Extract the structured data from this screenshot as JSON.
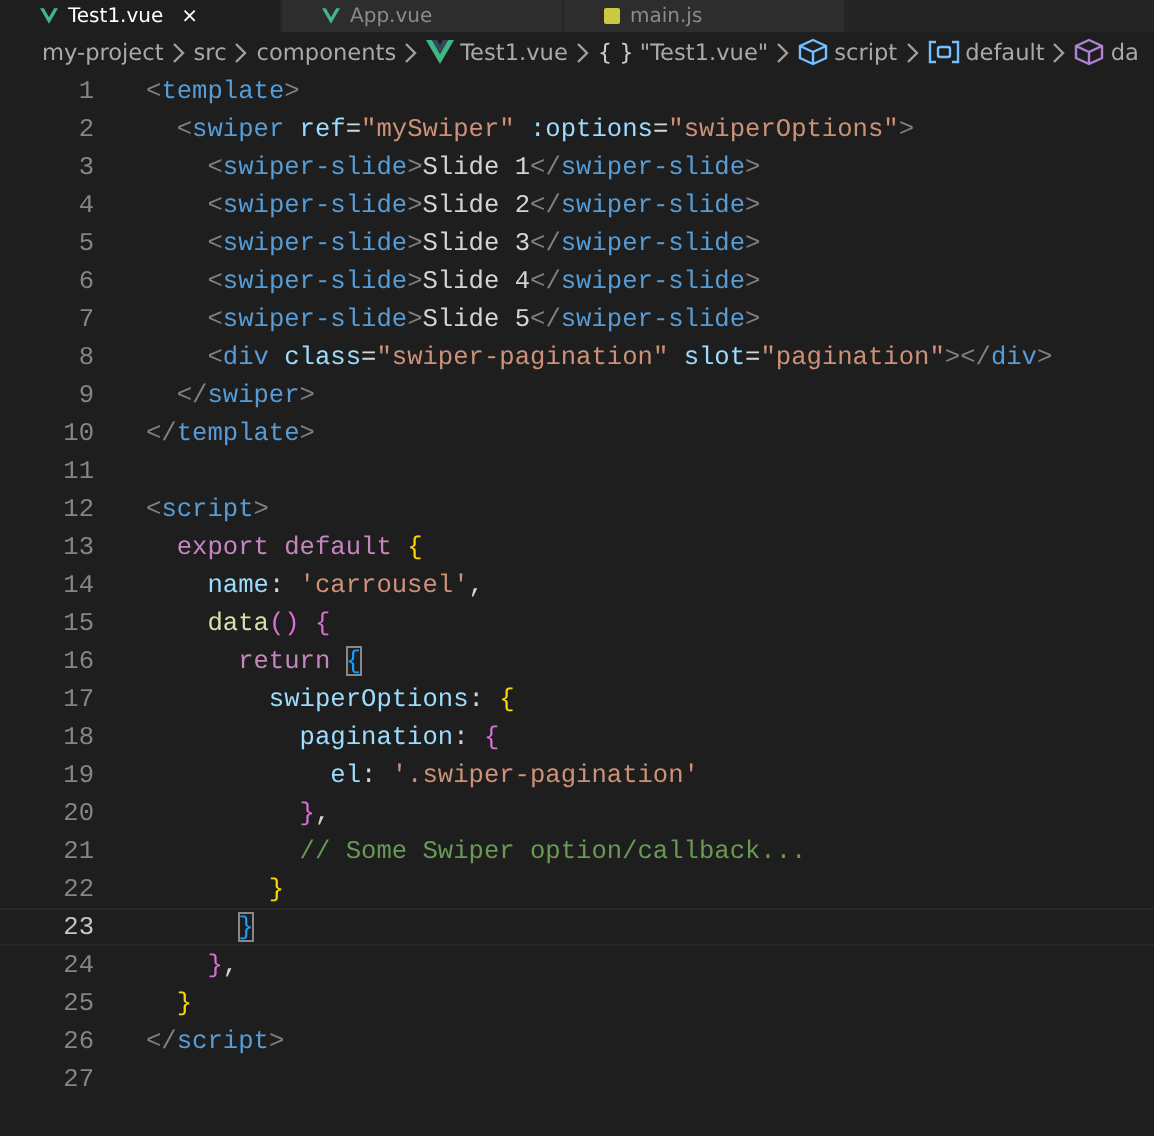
{
  "tabs": [
    {
      "label": "Test1.vue",
      "kind": "vue",
      "selected": true,
      "close": "×"
    },
    {
      "label": "App.vue",
      "kind": "vue",
      "selected": false
    },
    {
      "label": "main.js",
      "kind": "js",
      "selected": false
    }
  ],
  "breadcrumb": [
    {
      "label": "my-project",
      "kind": "folder"
    },
    {
      "label": "src",
      "kind": "folder"
    },
    {
      "label": "components",
      "kind": "folder"
    },
    {
      "label": "Test1.vue",
      "kind": "vue"
    },
    {
      "label": "\"Test1.vue\"",
      "kind": "braces",
      "glyph": "{ }"
    },
    {
      "label": "script",
      "kind": "cube"
    },
    {
      "label": "default",
      "kind": "field"
    },
    {
      "label": "da",
      "kind": "module"
    }
  ],
  "lines": [
    {
      "n": "1",
      "current": false,
      "tokens": [
        {
          "kind": "p",
          "t": "<"
        },
        {
          "kind": "tag",
          "t": "template"
        },
        {
          "kind": "p",
          "t": ">"
        }
      ]
    },
    {
      "n": "2",
      "current": false,
      "tokens": [
        {
          "kind": "p",
          "t": "  <"
        },
        {
          "kind": "tag",
          "t": "swiper"
        },
        {
          "kind": "attr",
          "t": " ref"
        },
        {
          "kind": "txt",
          "t": "="
        },
        {
          "kind": "str",
          "t": "\"mySwiper\""
        },
        {
          "kind": "attr",
          "t": " :options"
        },
        {
          "kind": "txt",
          "t": "="
        },
        {
          "kind": "str",
          "t": "\"swiperOptions\""
        },
        {
          "kind": "p",
          "t": ">"
        }
      ]
    },
    {
      "n": "3",
      "current": false,
      "tokens": [
        {
          "kind": "p",
          "t": "    <"
        },
        {
          "kind": "tag",
          "t": "swiper-slide"
        },
        {
          "kind": "p",
          "t": ">"
        },
        {
          "kind": "txt",
          "t": "Slide 1"
        },
        {
          "kind": "p",
          "t": "</"
        },
        {
          "kind": "tag",
          "t": "swiper-slide"
        },
        {
          "kind": "p",
          "t": ">"
        }
      ]
    },
    {
      "n": "4",
      "current": false,
      "tokens": [
        {
          "kind": "p",
          "t": "    <"
        },
        {
          "kind": "tag",
          "t": "swiper-slide"
        },
        {
          "kind": "p",
          "t": ">"
        },
        {
          "kind": "txt",
          "t": "Slide 2"
        },
        {
          "kind": "p",
          "t": "</"
        },
        {
          "kind": "tag",
          "t": "swiper-slide"
        },
        {
          "kind": "p",
          "t": ">"
        }
      ]
    },
    {
      "n": "5",
      "current": false,
      "tokens": [
        {
          "kind": "p",
          "t": "    <"
        },
        {
          "kind": "tag",
          "t": "swiper-slide"
        },
        {
          "kind": "p",
          "t": ">"
        },
        {
          "kind": "txt",
          "t": "Slide 3"
        },
        {
          "kind": "p",
          "t": "</"
        },
        {
          "kind": "tag",
          "t": "swiper-slide"
        },
        {
          "kind": "p",
          "t": ">"
        }
      ]
    },
    {
      "n": "6",
      "current": false,
      "tokens": [
        {
          "kind": "p",
          "t": "    <"
        },
        {
          "kind": "tag",
          "t": "swiper-slide"
        },
        {
          "kind": "p",
          "t": ">"
        },
        {
          "kind": "txt",
          "t": "Slide 4"
        },
        {
          "kind": "p",
          "t": "</"
        },
        {
          "kind": "tag",
          "t": "swiper-slide"
        },
        {
          "kind": "p",
          "t": ">"
        }
      ]
    },
    {
      "n": "7",
      "current": false,
      "tokens": [
        {
          "kind": "p",
          "t": "    <"
        },
        {
          "kind": "tag",
          "t": "swiper-slide"
        },
        {
          "kind": "p",
          "t": ">"
        },
        {
          "kind": "txt",
          "t": "Slide 5"
        },
        {
          "kind": "p",
          "t": "</"
        },
        {
          "kind": "tag",
          "t": "swiper-slide"
        },
        {
          "kind": "p",
          "t": ">"
        }
      ]
    },
    {
      "n": "8",
      "current": false,
      "tokens": [
        {
          "kind": "p",
          "t": "    <"
        },
        {
          "kind": "tag",
          "t": "div"
        },
        {
          "kind": "attr",
          "t": " class"
        },
        {
          "kind": "txt",
          "t": "="
        },
        {
          "kind": "str",
          "t": "\"swiper-pagination\""
        },
        {
          "kind": "attr",
          "t": " slot"
        },
        {
          "kind": "txt",
          "t": "="
        },
        {
          "kind": "str",
          "t": "\"pagination\""
        },
        {
          "kind": "p",
          "t": "></"
        },
        {
          "kind": "tag",
          "t": "div"
        },
        {
          "kind": "p",
          "t": ">"
        }
      ]
    },
    {
      "n": "9",
      "current": false,
      "tokens": [
        {
          "kind": "p",
          "t": "  </"
        },
        {
          "kind": "tag",
          "t": "swiper"
        },
        {
          "kind": "p",
          "t": ">"
        }
      ]
    },
    {
      "n": "10",
      "current": false,
      "tokens": [
        {
          "kind": "p",
          "t": "</"
        },
        {
          "kind": "tag",
          "t": "template"
        },
        {
          "kind": "p",
          "t": ">"
        }
      ]
    },
    {
      "n": "11",
      "current": false
    },
    {
      "n": "12",
      "current": false,
      "tokens": [
        {
          "kind": "p",
          "t": "<"
        },
        {
          "kind": "tag",
          "t": "script"
        },
        {
          "kind": "p",
          "t": ">"
        }
      ]
    },
    {
      "n": "13",
      "current": false,
      "tokens": [
        {
          "kind": "kw",
          "t": "  export default "
        },
        {
          "kind": "b1",
          "t": "{"
        }
      ]
    },
    {
      "n": "14",
      "current": false,
      "tokens": [
        {
          "kind": "prop",
          "t": "    name"
        },
        {
          "kind": "txt",
          "t": ": "
        },
        {
          "kind": "str",
          "t": "'carrousel'"
        },
        {
          "kind": "txt",
          "t": ","
        }
      ]
    },
    {
      "n": "15",
      "current": false,
      "tokens": [
        {
          "kind": "fn",
          "t": "    data"
        },
        {
          "kind": "b2",
          "t": "()"
        },
        {
          "kind": "b2",
          "t": " {"
        }
      ]
    },
    {
      "n": "16",
      "current": false,
      "tokens": [
        {
          "kind": "kw",
          "t": "      return "
        },
        {
          "kind": "b3",
          "t": "{",
          "match": true
        }
      ]
    },
    {
      "n": "17",
      "current": false,
      "tokens": [
        {
          "kind": "prop",
          "t": "        swiperOptions"
        },
        {
          "kind": "txt",
          "t": ": "
        },
        {
          "kind": "b1",
          "t": "{"
        }
      ]
    },
    {
      "n": "18",
      "current": false,
      "tokens": [
        {
          "kind": "prop",
          "t": "          pagination"
        },
        {
          "kind": "txt",
          "t": ": "
        },
        {
          "kind": "b2",
          "t": "{"
        }
      ]
    },
    {
      "n": "19",
      "current": false,
      "tokens": [
        {
          "kind": "prop",
          "t": "            el"
        },
        {
          "kind": "txt",
          "t": ": "
        },
        {
          "kind": "str",
          "t": "'.swiper-pagination'"
        }
      ]
    },
    {
      "n": "20",
      "current": false,
      "tokens": [
        {
          "kind": "b2",
          "t": "          }"
        },
        {
          "kind": "txt",
          "t": ","
        }
      ]
    },
    {
      "n": "21",
      "current": false,
      "tokens": [
        {
          "kind": "cm",
          "t": "          // Some Swiper option/callback..."
        }
      ]
    },
    {
      "n": "22",
      "current": false,
      "tokens": [
        {
          "kind": "b1",
          "t": "        }"
        }
      ]
    },
    {
      "n": "23",
      "current": true,
      "tokens": [
        {
          "kind": "b3",
          "t": "      }",
          "match": true
        }
      ]
    },
    {
      "n": "24",
      "current": false,
      "tokens": [
        {
          "kind": "b2",
          "t": "    }"
        },
        {
          "kind": "txt",
          "t": ","
        }
      ]
    },
    {
      "n": "25",
      "current": false,
      "tokens": [
        {
          "kind": "b1",
          "t": "  }"
        }
      ]
    },
    {
      "n": "26",
      "current": false,
      "tokens": [
        {
          "kind": "p",
          "t": "</"
        },
        {
          "kind": "tag",
          "t": "script"
        },
        {
          "kind": "p",
          "t": ">"
        }
      ]
    },
    {
      "n": "27",
      "current": false
    }
  ]
}
